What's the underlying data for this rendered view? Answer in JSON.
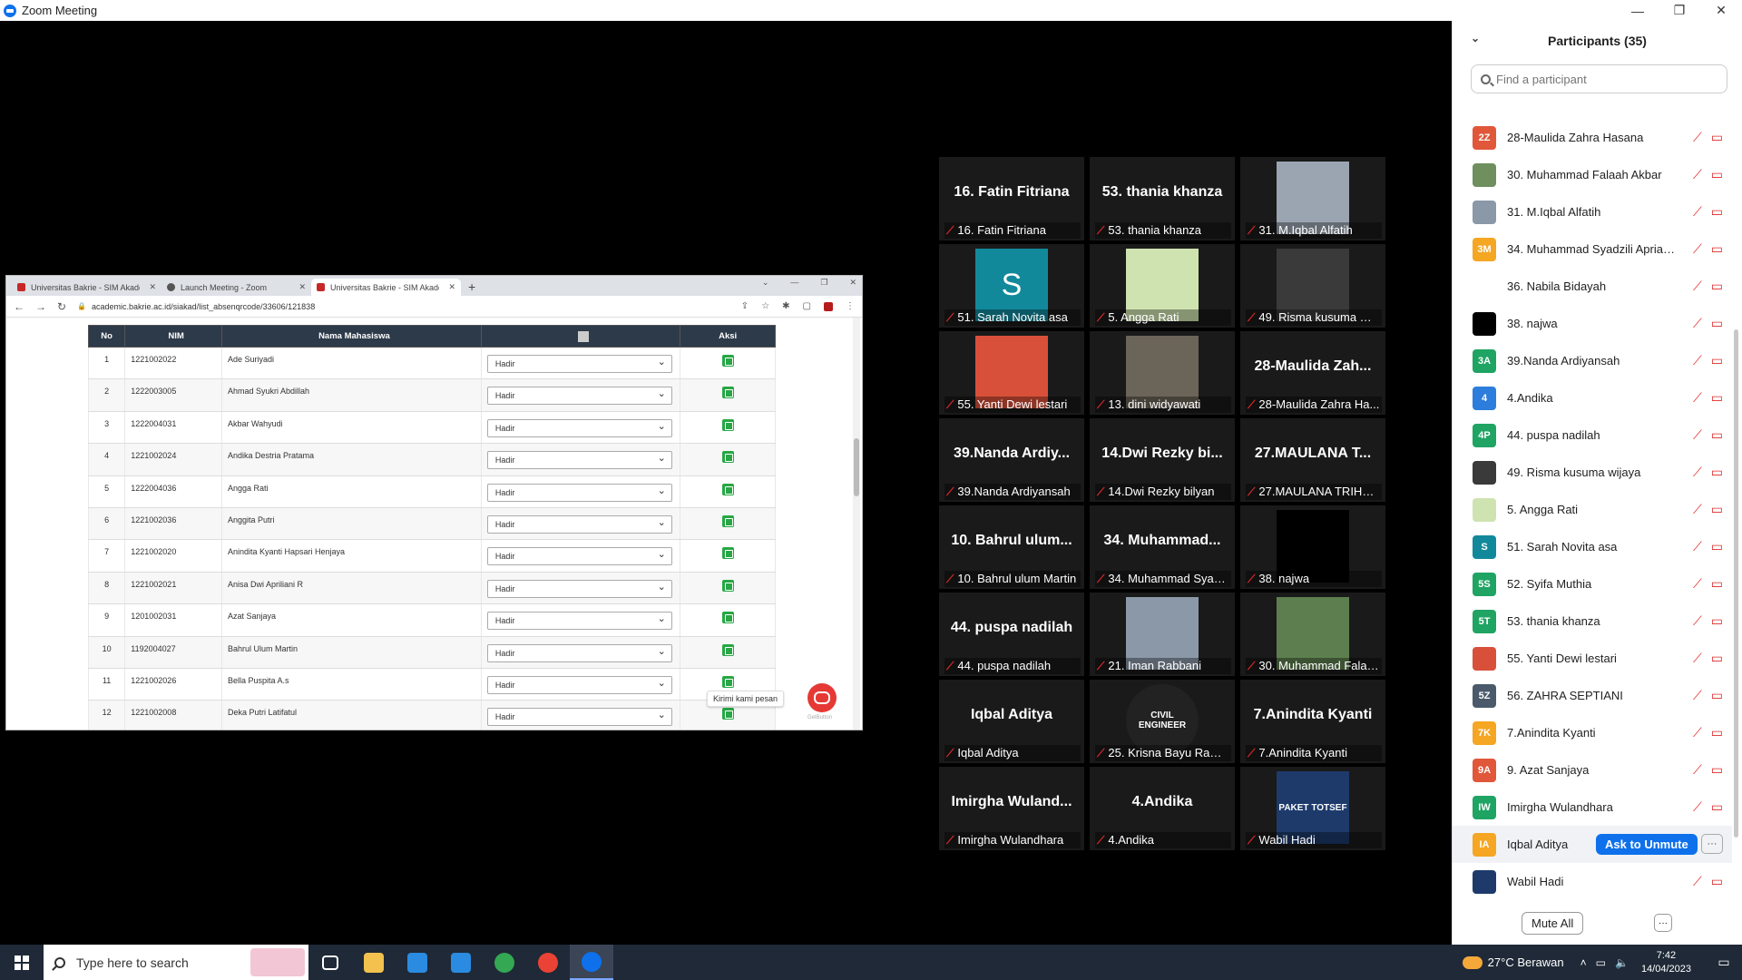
{
  "window": {
    "title": "Zoom Meeting",
    "controls": [
      "—",
      "❐",
      "✕"
    ]
  },
  "browser": {
    "tabs": [
      {
        "title": "Universitas Bakrie - SIM Akadem",
        "color": "#c62828",
        "active": false
      },
      {
        "title": "Launch Meeting - Zoom",
        "color": "#555555",
        "active": false
      },
      {
        "title": "Universitas Bakrie - SIM Akadem",
        "color": "#c62828",
        "active": true
      }
    ],
    "url": "academic.bakrie.ac.id/siakad/list_absenqrcode/33606/121838",
    "table": {
      "headers": [
        "No",
        "NIM",
        "Nama Mahasiswa",
        "",
        "Aksi"
      ],
      "rows": [
        {
          "no": "1",
          "nim": "1221002022",
          "nama": "Ade Suriyadi",
          "status": "Hadir"
        },
        {
          "no": "2",
          "nim": "1222003005",
          "nama": "Ahmad Syukri Abdillah",
          "status": "Hadir"
        },
        {
          "no": "3",
          "nim": "1222004031",
          "nama": "Akbar Wahyudi",
          "status": "Hadir"
        },
        {
          "no": "4",
          "nim": "1221002024",
          "nama": "Andika Destria Pratama",
          "status": "Hadir"
        },
        {
          "no": "5",
          "nim": "1222004036",
          "nama": "Angga Rati",
          "status": "Hadir"
        },
        {
          "no": "6",
          "nim": "1221002036",
          "nama": "Anggita Putri",
          "status": "Hadir"
        },
        {
          "no": "7",
          "nim": "1221002020",
          "nama": "Anindita Kyanti Hapsari Henjaya",
          "status": "Hadir"
        },
        {
          "no": "8",
          "nim": "1221002021",
          "nama": "Anisa Dwi Apriliani R",
          "status": "Hadir"
        },
        {
          "no": "9",
          "nim": "1201002031",
          "nama": "Azat Sanjaya",
          "status": "Hadir"
        },
        {
          "no": "10",
          "nim": "1192004027",
          "nama": "Bahrul Ulum Martin",
          "status": "Hadir"
        },
        {
          "no": "11",
          "nim": "1221002026",
          "nama": "Bella Puspita A.s",
          "status": "Hadir"
        },
        {
          "no": "12",
          "nim": "1221002008",
          "nama": "Deka Putri Latifatul",
          "status": "Hadir"
        }
      ]
    },
    "chat_tooltip": "Kirimi kami pesan",
    "chat_brand": "GetButton"
  },
  "gallery": [
    {
      "big": "16. Fatin Fitriana",
      "label": "16. Fatin Fitriana",
      "pic": null
    },
    {
      "big": "53. thania khanza",
      "label": "53. thania khanza",
      "pic": null
    },
    {
      "big": "",
      "label": "31. M.Iqbal Alfatih",
      "pic": "#9aa5b1"
    },
    {
      "big": "",
      "label": "51. Sarah Novita asa",
      "pic": "#12899b",
      "pic_letter": "S"
    },
    {
      "big": "",
      "label": "5. Angga Rati",
      "pic": "#cfe3b0"
    },
    {
      "big": "",
      "label": "49. Risma kusuma wij...",
      "pic": "#3a3a3a"
    },
    {
      "big": "",
      "label": "55. Yanti Dewi lestari",
      "pic": "#d9503a"
    },
    {
      "big": "",
      "label": "13. dini widyawati",
      "pic": "#6b6458"
    },
    {
      "big": "28-Maulida Zah...",
      "label": "28-Maulida Zahra Ha...",
      "pic": null
    },
    {
      "big": "39.Nanda Ardiy...",
      "label": "39.Nanda Ardiyansah",
      "pic": null
    },
    {
      "big": "14.Dwi Rezky bi...",
      "label": "14.Dwi Rezky bilyan",
      "pic": null
    },
    {
      "big": "27.MAULANA T...",
      "label": "27.MAULANA TRIHAT...",
      "pic": null
    },
    {
      "big": "10. Bahrul ulum...",
      "label": "10. Bahrul ulum Martin",
      "pic": null
    },
    {
      "big": "34.  Muhammad...",
      "label": "34. Muhammad Syad...",
      "pic": null
    },
    {
      "big": "",
      "label": "38. najwa",
      "pic": "#000000"
    },
    {
      "big": "44. puspa nadilah",
      "label": "44. puspa nadilah",
      "pic": null
    },
    {
      "big": "",
      "label": "21. Iman Rabbani",
      "pic": "#8a98a8"
    },
    {
      "big": "",
      "label": "30. Muhammad Falaa...",
      "pic": "#5d7f4f"
    },
    {
      "big": "Iqbal Aditya",
      "label": "Iqbal Aditya",
      "pic": null
    },
    {
      "big": "",
      "label": "25. Krisna Bayu Rama...",
      "pic": "#222222",
      "pic_text": "CIVIL ENGINEER"
    },
    {
      "big": "7.Anindita Kyanti",
      "label": "7.Anindita Kyanti",
      "pic": null
    },
    {
      "big": "Imirgha  Wuland...",
      "label": "Imirgha Wulandhara",
      "pic": null
    },
    {
      "big": "4.Andika",
      "label": "4.Andika",
      "pic": null
    },
    {
      "big": "",
      "label": "Wabil Hadi",
      "pic": "#1d3a6b",
      "pic_text": "PAKET TOTSEF"
    }
  ],
  "participants": {
    "title": "Participants (35)",
    "search_placeholder": "Find a participant",
    "list": [
      {
        "initials": "2Z",
        "color": "#e0573a",
        "name": "28-Maulida Zahra Hasana"
      },
      {
        "initials": "",
        "color": "#6f8f5f",
        "name": "30. Muhammad Falaah Akbar"
      },
      {
        "initials": "",
        "color": "#8a98a8",
        "name": "31. M.Iqbal Alfatih"
      },
      {
        "initials": "3M",
        "color": "#f5a623",
        "name": "34. Muhammad Syadzili Aprian..."
      },
      {
        "initials": "",
        "color": "#ffffff",
        "name": "36. Nabila Bidayah"
      },
      {
        "initials": "",
        "color": "#000000",
        "name": "38. najwa"
      },
      {
        "initials": "3A",
        "color": "#1fa463",
        "name": "39.Nanda Ardiyansah"
      },
      {
        "initials": "4",
        "color": "#2d7ddc",
        "name": "4.Andika"
      },
      {
        "initials": "4P",
        "color": "#1fa463",
        "name": "44. puspa nadilah"
      },
      {
        "initials": "",
        "color": "#3a3a3a",
        "name": "49. Risma kusuma wijaya"
      },
      {
        "initials": "",
        "color": "#cfe3b0",
        "name": "5. Angga Rati"
      },
      {
        "initials": "S",
        "color": "#12899b",
        "name": "51. Sarah Novita asa"
      },
      {
        "initials": "5S",
        "color": "#1fa463",
        "name": "52. Syifa Muthia"
      },
      {
        "initials": "5T",
        "color": "#1fa463",
        "name": "53. thania khanza"
      },
      {
        "initials": "",
        "color": "#d9503a",
        "name": "55. Yanti Dewi lestari"
      },
      {
        "initials": "5Z",
        "color": "#4a5a6a",
        "name": "56. ZAHRA SEPTIANI"
      },
      {
        "initials": "7K",
        "color": "#f5a623",
        "name": "7.Anindita Kyanti"
      },
      {
        "initials": "9A",
        "color": "#e0573a",
        "name": "9. Azat Sanjaya"
      },
      {
        "initials": "IW",
        "color": "#1fa463",
        "name": "Imirgha Wulandhara"
      },
      {
        "initials": "IA",
        "color": "#f5a623",
        "name": "Iqbal Aditya",
        "highlight": true
      },
      {
        "initials": "",
        "color": "#1d3a6b",
        "name": "Wabil Hadi"
      }
    ],
    "ask_to_unmute": "Ask to Unmute",
    "mute_all": "Mute All",
    "more": "···"
  },
  "taskbar": {
    "search_placeholder": "Type here to search",
    "weather": "27°C  Berawan",
    "time": "7:42",
    "date": "14/04/2023",
    "apps": [
      {
        "name": "task-view",
        "color": "#ffffff"
      },
      {
        "name": "file-explorer",
        "color": "#f2c14e"
      },
      {
        "name": "store",
        "color": "#2a8be0"
      },
      {
        "name": "mail",
        "color": "#2a8be0"
      },
      {
        "name": "chrome",
        "color": "#34a853"
      },
      {
        "name": "chrome-profile",
        "color": "#ea4335"
      },
      {
        "name": "zoom",
        "color": "#0e71eb"
      }
    ]
  }
}
